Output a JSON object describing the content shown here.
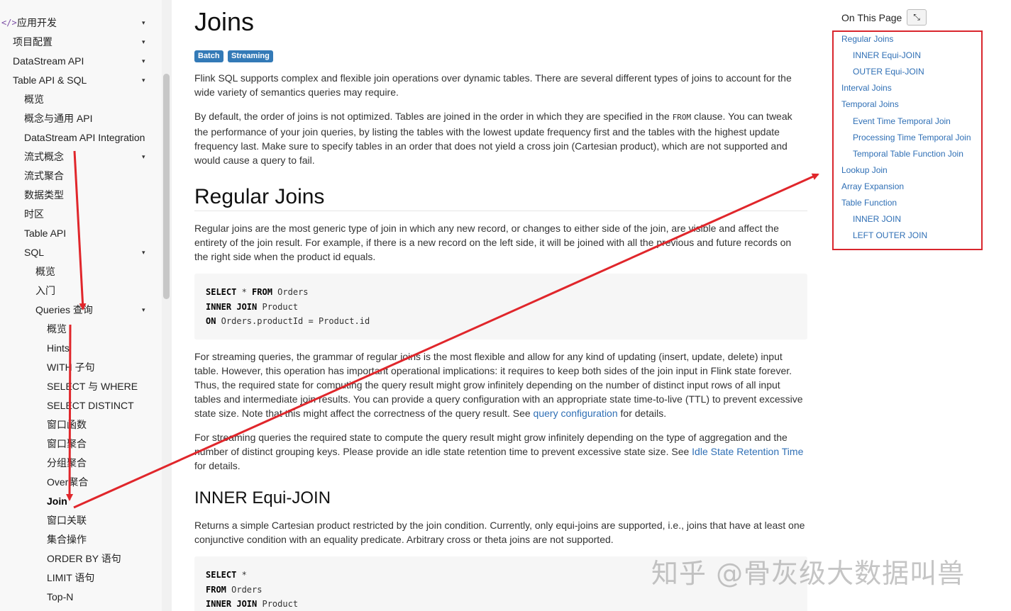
{
  "sidebar": {
    "items": [
      {
        "label": "应用开发",
        "caret": "▾",
        "active": false
      },
      {
        "label": "项目配置",
        "caret": "▾",
        "active": false
      },
      {
        "label": "DataStream API",
        "caret": "▾",
        "active": false
      },
      {
        "label": "Table API & SQL",
        "caret": "▾",
        "active": false
      },
      {
        "label": "概览",
        "caret": "",
        "active": false
      },
      {
        "label": "概念与通用 API",
        "caret": "",
        "active": false
      },
      {
        "label": "DataStream API Integration",
        "caret": "",
        "active": false
      },
      {
        "label": "流式概念",
        "caret": "▾",
        "active": false
      },
      {
        "label": "流式聚合",
        "caret": "",
        "active": false
      },
      {
        "label": "数据类型",
        "caret": "",
        "active": false
      },
      {
        "label": "时区",
        "caret": "",
        "active": false
      },
      {
        "label": "Table API",
        "caret": "",
        "active": false
      },
      {
        "label": "SQL",
        "caret": "▾",
        "active": false
      },
      {
        "label": "概览",
        "caret": "",
        "active": false
      },
      {
        "label": "入门",
        "caret": "",
        "active": false
      },
      {
        "label": "Queries 查询",
        "caret": "▾",
        "active": false
      },
      {
        "label": "概览",
        "caret": "",
        "active": false
      },
      {
        "label": "Hints",
        "caret": "",
        "active": false
      },
      {
        "label": "WITH 子句",
        "caret": "",
        "active": false
      },
      {
        "label": "SELECT 与 WHERE",
        "caret": "",
        "active": false
      },
      {
        "label": "SELECT DISTINCT",
        "caret": "",
        "active": false
      },
      {
        "label": "窗口函数",
        "caret": "",
        "active": false
      },
      {
        "label": "窗口聚合",
        "caret": "",
        "active": false
      },
      {
        "label": "分组聚合",
        "caret": "",
        "active": false
      },
      {
        "label": "Over聚合",
        "caret": "",
        "active": false
      },
      {
        "label": "Join",
        "caret": "",
        "active": true
      },
      {
        "label": "窗口关联",
        "caret": "",
        "active": false
      },
      {
        "label": "集合操作",
        "caret": "",
        "active": false
      },
      {
        "label": "ORDER BY 语句",
        "caret": "",
        "active": false
      },
      {
        "label": "LIMIT 语句",
        "caret": "",
        "active": false
      },
      {
        "label": "Top-N",
        "caret": "",
        "active": false
      }
    ]
  },
  "main": {
    "title": "Joins",
    "badges": [
      "Batch",
      "Streaming"
    ],
    "intro1": "Flink SQL supports complex and flexible join operations over dynamic tables. There are several different types of joins to account for the wide variety of semantics queries may require.",
    "intro2_a": "By default, the order of joins is not optimized. Tables are joined in the order in which they are specified in the ",
    "intro2_code": "FROM",
    "intro2_b": " clause. You can tweak the performance of your join queries, by listing the tables with the lowest update frequency first and the tables with the highest update frequency last. Make sure to specify tables in an order that does not yield a cross join (Cartesian product), which are not supported and would cause a query to fail.",
    "regular_heading": "Regular Joins",
    "regular_p1": "Regular joins are the most generic type of join in which any new record, or changes to either side of the join, are visible and affect the entirety of the join result. For example, if there is a new record on the left side, it will be joined with all the previous and future records on the right side when the product id equals.",
    "code1": [
      {
        "kw": "SELECT",
        "rest": " * ",
        "kw2": "FROM",
        "rest2": " Orders"
      },
      {
        "kw": "INNER JOIN",
        "rest": " Product",
        "kw2": "",
        "rest2": ""
      },
      {
        "kw": "ON",
        "rest": " Orders.productId = Product.id",
        "kw2": "",
        "rest2": ""
      }
    ],
    "regular_p2_a": "For streaming queries, the grammar of regular joins is the most flexible and allow for any kind of updating (insert, update, delete) input table. However, this operation has important operational implications: it requires to keep both sides of the join input in Flink state forever. Thus, the required state for computing the query result might grow infinitely depending on the number of distinct input rows of all input tables and intermediate join results. You can provide a query configuration with an appropriate state time-to-live (TTL) to prevent excessive state size. Note that this might affect the correctness of the query result. See ",
    "regular_p2_link": "query configuration",
    "regular_p2_b": " for details.",
    "regular_p3_a": "For streaming queries the required state to compute the query result might grow infinitely depending on the type of aggregation and the number of distinct grouping keys. Please provide an idle state retention time to prevent excessive state size. See ",
    "regular_p3_link": "Idle State Retention Time",
    "regular_p3_b": " for details.",
    "inner_heading": "INNER Equi-JOIN",
    "inner_p1": "Returns a simple Cartesian product restricted by the join condition. Currently, only equi-joins are supported, i.e., joins that have at least one conjunctive condition with an equality predicate. Arbitrary cross or theta joins are not supported.",
    "code2": [
      {
        "kw": "SELECT",
        "rest": " *"
      },
      {
        "kw": "FROM",
        "rest": " Orders"
      },
      {
        "kw": "INNER JOIN",
        "rest": " Product"
      }
    ]
  },
  "toc": {
    "title": "On This Page",
    "toggle_glyph": "⤡",
    "items": [
      {
        "label": "Regular Joins",
        "level": 0
      },
      {
        "label": "INNER Equi-JOIN",
        "level": 1
      },
      {
        "label": "OUTER Equi-JOIN",
        "level": 1
      },
      {
        "label": "Interval Joins",
        "level": 0
      },
      {
        "label": "Temporal Joins",
        "level": 0
      },
      {
        "label": "Event Time Temporal Join",
        "level": 1
      },
      {
        "label": "Processing Time Temporal Join",
        "level": 1
      },
      {
        "label": "Temporal Table Function Join",
        "level": 1
      },
      {
        "label": "Lookup Join",
        "level": 0
      },
      {
        "label": "Array Expansion",
        "level": 0
      },
      {
        "label": "Table Function",
        "level": 0
      },
      {
        "label": "INNER JOIN",
        "level": 1
      },
      {
        "label": "LEFT OUTER JOIN",
        "level": 1
      }
    ]
  },
  "watermark": "知乎 @骨灰级大数据叫兽",
  "colors": {
    "annotation_red": "#e0262b",
    "badge_blue": "#337ab7",
    "link_blue": "#2f6fb5"
  }
}
